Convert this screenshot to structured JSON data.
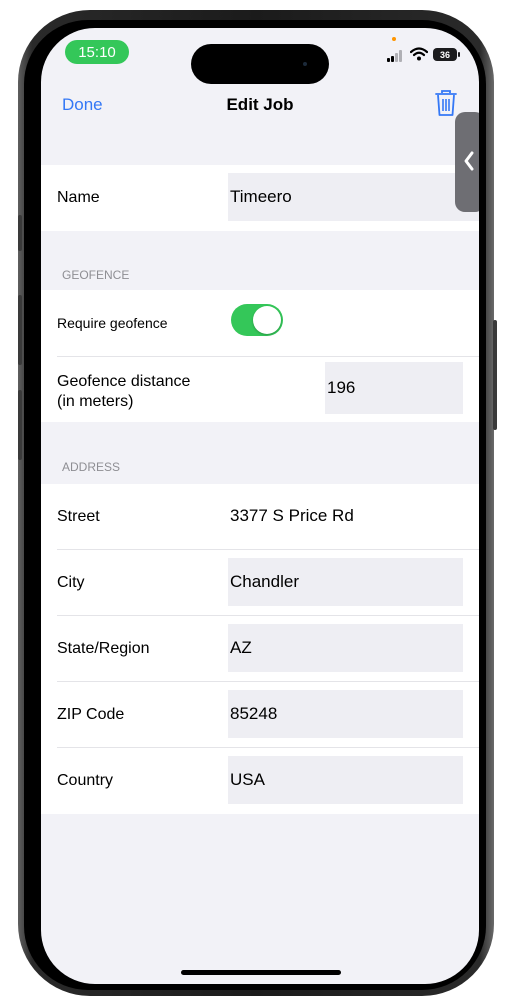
{
  "status": {
    "time": "15:10",
    "battery": "36"
  },
  "nav": {
    "done": "Done",
    "title": "Edit Job"
  },
  "name": {
    "label": "Name",
    "value": "Timeero"
  },
  "geofence": {
    "header": "GEOFENCE",
    "require_label": "Require geofence",
    "require_on": true,
    "distance_label_line1": "Geofence distance",
    "distance_label_line2": "(in meters)",
    "distance_value": "196"
  },
  "address": {
    "header": "ADDRESS",
    "street_label": "Street",
    "street_value": "3377 S Price Rd",
    "city_label": "City",
    "city_value": "Chandler",
    "state_label": "State/Region",
    "state_value": "AZ",
    "zip_label": "ZIP Code",
    "zip_value": "85248",
    "country_label": "Country",
    "country_value": "USA"
  },
  "colors": {
    "accent": "#3478f6",
    "toggle_on": "#34c759",
    "background": "#f2f2f7"
  }
}
